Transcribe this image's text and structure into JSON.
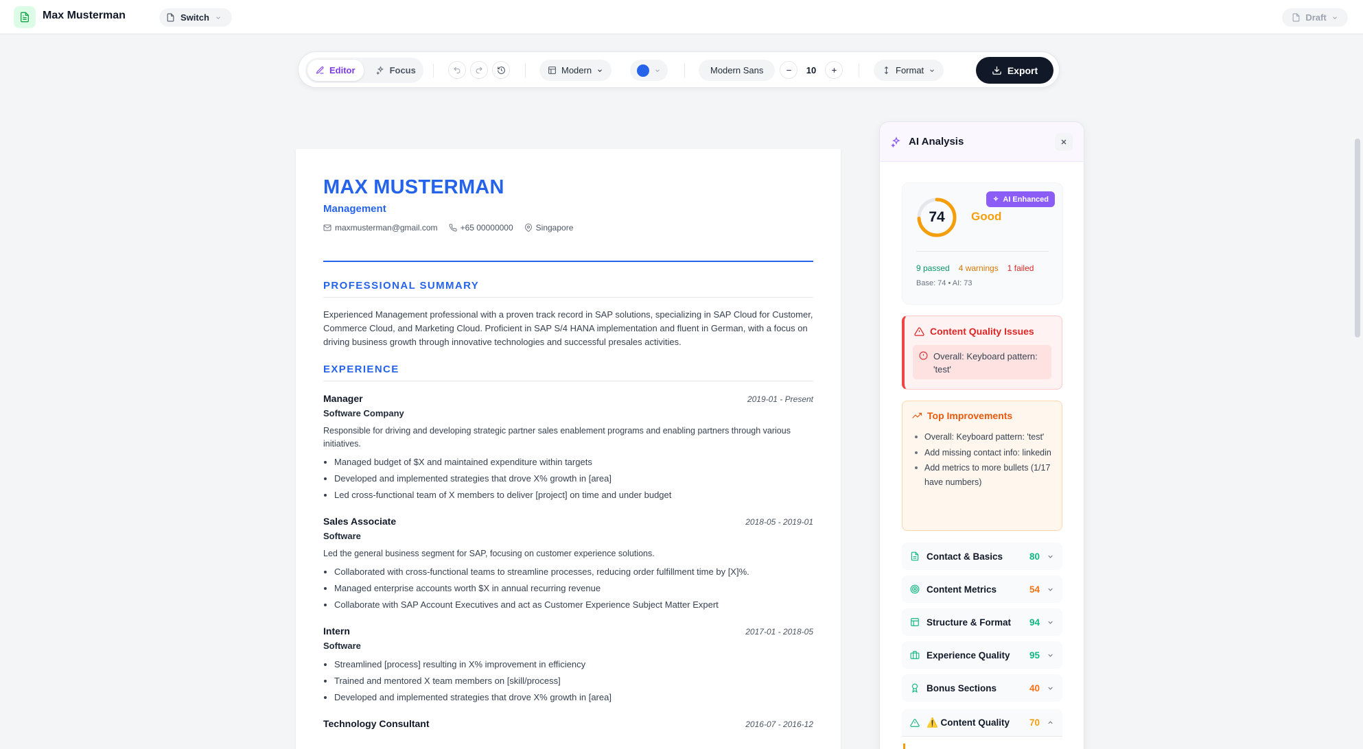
{
  "app": {
    "name": "Max Musterman",
    "switch_label": "Switch",
    "draft_label": "Draft"
  },
  "toolbar": {
    "editor_label": "Editor",
    "focus_label": "Focus",
    "template_label": "Modern",
    "accent_color": "#2563eb",
    "font_label": "Modern Sans",
    "font_size": "10",
    "format_label": "Format",
    "export_label": "Export"
  },
  "resume": {
    "name": "MAX MUSTERMAN",
    "title": "Management",
    "email": "maxmusterman@gmail.com",
    "phone": "+65 00000000",
    "location": "Singapore",
    "summary_heading": "PROFESSIONAL SUMMARY",
    "summary": "Experienced Management professional with a proven track record in SAP solutions, specializing in SAP Cloud for Customer, Commerce Cloud, and Marketing Cloud. Proficient in SAP S/4 HANA implementation and fluent in German, with a focus on driving business growth through innovative technologies and successful presales activities.",
    "experience_heading": "EXPERIENCE",
    "jobs": [
      {
        "role": "Manager",
        "dates": "2019-01 - Present",
        "company": "Software Company",
        "desc": "Responsible for driving and developing strategic partner sales enablement programs and enabling partners through various initiatives.",
        "bullets": [
          "Managed budget of $X and maintained expenditure within targets",
          "Developed and implemented strategies that drove X% growth in [area]",
          "Led cross-functional team of X members to deliver [project] on time and under budget"
        ]
      },
      {
        "role": "Sales Associate",
        "dates": "2018-05 - 2019-01",
        "company": "Software",
        "desc": "Led the general business segment for SAP, focusing on customer experience solutions.",
        "bullets": [
          "Collaborated with cross-functional teams to streamline processes, reducing order fulfillment time by [X]%.",
          "Managed enterprise accounts worth $X in annual recurring revenue",
          "Collaborate with SAP Account Executives and act as Customer Experience Subject Matter Expert"
        ]
      },
      {
        "role": "Intern",
        "dates": "2017-01 - 2018-05",
        "company": "Software",
        "bullets": [
          "Streamlined [process] resulting in X% improvement in efficiency",
          "Trained and mentored X team members on [skill/process]",
          "Developed and implemented strategies that drove X% growth in [area]"
        ]
      },
      {
        "role": "Technology Consultant",
        "dates": "2016-07 - 2016-12"
      }
    ]
  },
  "ai": {
    "title": "AI Analysis",
    "score": "74",
    "score_value": 74,
    "rating": "Good",
    "badge": "AI Enhanced",
    "passed": "9 passed",
    "warnings": "4 warnings",
    "failed": "1 failed",
    "base": "Base: 74 • AI: 73",
    "content_issues_title": "Content Quality Issues",
    "content_issue": "Overall: Keyboard pattern: 'test'",
    "improvements_title": "Top Improvements",
    "improvements": [
      "Overall: Keyboard pattern: 'test'",
      "Add missing contact info: linkedin",
      "Add metrics to more bullets (1/17 have numbers)"
    ],
    "categories": [
      {
        "name": "Contact & Basics",
        "score": "80",
        "color": "green"
      },
      {
        "name": "Content Metrics",
        "score": "54",
        "color": "orange"
      },
      {
        "name": "Structure & Format",
        "score": "94",
        "color": "green"
      },
      {
        "name": "Experience Quality",
        "score": "95",
        "color": "green"
      },
      {
        "name": "Bonus Sections",
        "score": "40",
        "color": "orange"
      },
      {
        "name": "⚠️ Content Quality",
        "score": "70",
        "color": "amber"
      }
    ]
  }
}
